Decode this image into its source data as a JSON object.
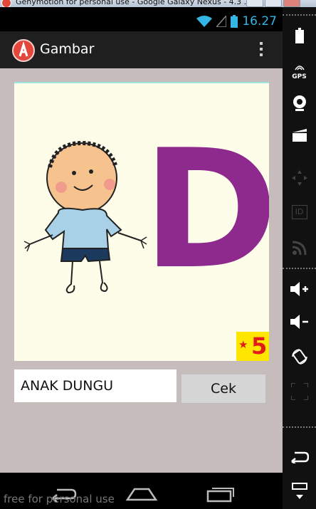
{
  "window": {
    "title": "Genymotion for personal use - Google Galaxy Nexus - 4.3 ..."
  },
  "status_bar": {
    "time": "16.27",
    "icons": [
      "wifi-icon",
      "signal-icon",
      "battery-icon"
    ]
  },
  "action_bar": {
    "app_title": "Gambar",
    "overflow_icon": "overflow-menu-icon"
  },
  "content": {
    "picture": {
      "letter": "D",
      "badge": "5",
      "letter_color": "#8e2a8e"
    },
    "answer_value": "ANAK DUNGU",
    "check_button": "Cek"
  },
  "nav_bar": {
    "buttons": [
      "back-icon",
      "home-icon",
      "recent-apps-icon"
    ]
  },
  "watermark": "free for personal use",
  "toolbar": {
    "gps_label": "GPS",
    "id_label": "ID",
    "items": [
      "battery-icon",
      "gps-icon",
      "camera-icon",
      "video-icon",
      "dpad-icon",
      "id-icon",
      "rss-icon",
      "volume-up-icon",
      "volume-down-icon",
      "rotate-icon",
      "scale-icon",
      "back-icon",
      "menu-icon"
    ]
  },
  "colors": {
    "accent": "#33b5e5",
    "background": "#c7bcbc",
    "badge": "#ffe600",
    "badge_text": "#e21a1a"
  }
}
